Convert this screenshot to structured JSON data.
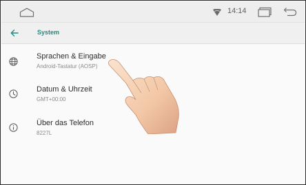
{
  "status_bar": {
    "time": "14:14",
    "icons": [
      "home-outline-icon",
      "wifi-icon",
      "recents-icon",
      "back-arrow-icon"
    ]
  },
  "app_bar": {
    "title": "System",
    "back_icon": "arrow-left-icon",
    "accent_color": "#1e8c7e"
  },
  "settings_items": [
    {
      "title": "Sprachen & Eingabe",
      "subtitle": "Android-Tastatur (AOSP)",
      "icon": "globe-icon"
    },
    {
      "title": "Datum & Uhrzeit",
      "subtitle": "GMT+00:00",
      "icon": "clock-icon"
    },
    {
      "title": "Über das Telefon",
      "subtitle": "8227L",
      "icon": "info-icon"
    }
  ],
  "overlay": {
    "icon": "pointing-hand-icon"
  }
}
